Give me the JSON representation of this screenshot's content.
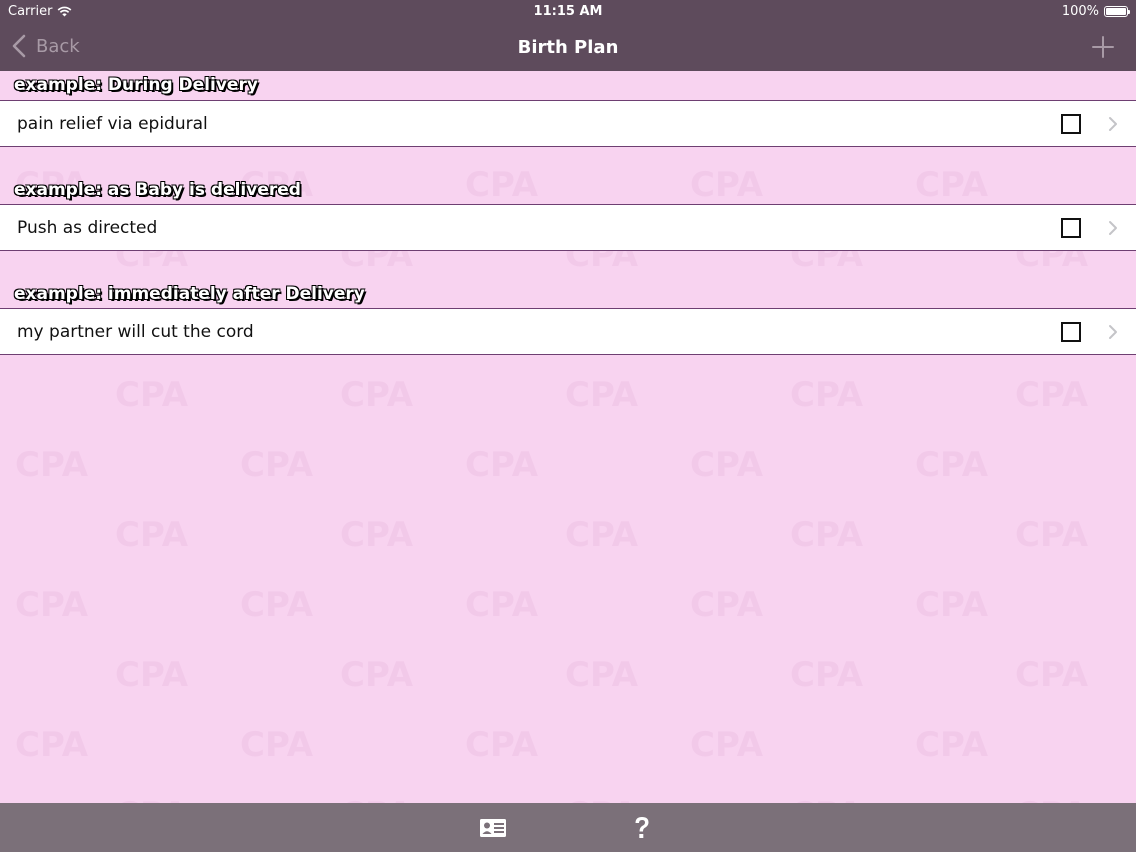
{
  "status_bar": {
    "carrier": "Carrier",
    "time": "11:15 AM",
    "battery": "100%"
  },
  "nav": {
    "back_label": "Back",
    "title": "Birth Plan"
  },
  "sections": [
    {
      "header": "example: During Delivery",
      "items": [
        {
          "label": "pain relief via epidural",
          "checked": false
        }
      ]
    },
    {
      "header": "example: as Baby is delivered",
      "items": [
        {
          "label": "Push as directed",
          "checked": false
        }
      ]
    },
    {
      "header": "example: immediately after Delivery",
      "items": [
        {
          "label": "my partner will cut the cord",
          "checked": false
        }
      ]
    }
  ],
  "tab_bar": {
    "items": [
      {
        "icon": "contact-card-icon"
      },
      {
        "icon": "help-icon"
      }
    ]
  },
  "colors": {
    "nav_background": "#5e4b5c",
    "page_background": "#f8d3f0",
    "row_border": "#6e3f72",
    "tab_background": "#7b7079"
  }
}
